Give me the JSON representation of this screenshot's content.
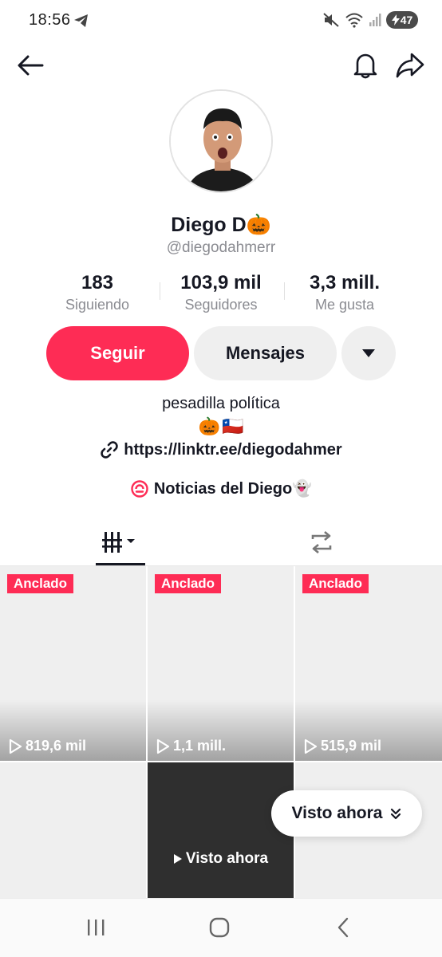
{
  "status_bar": {
    "time": "18:56",
    "battery": "47"
  },
  "profile": {
    "display_name": "Diego D🎃",
    "username": "@diegodahmerr",
    "follow_label": "Seguir",
    "message_label": "Mensajes",
    "bio": "pesadilla política",
    "bio_emojis": [
      "🎃",
      "🇨🇱"
    ],
    "link": "https://linktr.ee/diegodahmer",
    "news_label": "Noticias del Diego👻"
  },
  "stats": [
    {
      "value": "183",
      "label": "Siguiendo"
    },
    {
      "value": "103,9 mil",
      "label": "Seguidores"
    },
    {
      "value": "3,3 mill.",
      "label": "Me gusta"
    }
  ],
  "videos": [
    {
      "pinned": "Anclado",
      "views": "819,6 mil"
    },
    {
      "pinned": "Anclado",
      "views": "1,1 mill."
    },
    {
      "pinned": "Anclado",
      "views": "515,9 mil"
    }
  ],
  "watched_cell_label": "Visto ahora",
  "watched_chip_label": "Visto ahora",
  "colors": {
    "accent": "#fe2c55",
    "text": "#161823",
    "secondary_text": "#8a8b91"
  },
  "icons": [
    "arrow-left-icon",
    "bell-icon",
    "share-icon",
    "chevron-down-icon",
    "link-icon",
    "news-icon",
    "grid-icon",
    "repost-icon",
    "play-icon"
  ]
}
